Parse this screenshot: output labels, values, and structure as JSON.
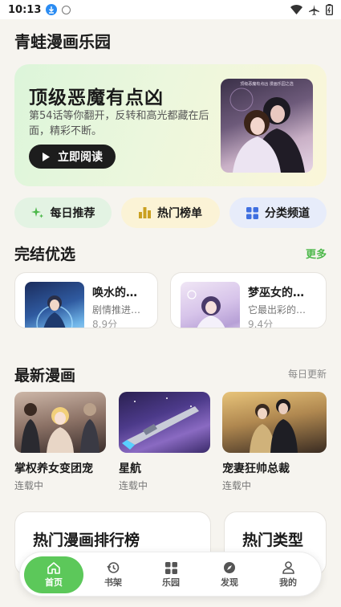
{
  "status": {
    "time": "10:13"
  },
  "app": {
    "title": "青蛙漫画乐园"
  },
  "hero": {
    "title": "顶级恶魔有点凶",
    "desc": "第54话等你翻开，反转和高光都藏在后面，精彩不断。",
    "button": "立即阅读",
    "cover_text": "顶级恶魔有点凶 漫画乐园之选"
  },
  "chips": [
    {
      "label": "每日推荐",
      "icon": "sparkle-icon",
      "color": "#4cb84a"
    },
    {
      "label": "热门榜单",
      "icon": "bar-chart-icon",
      "color": "#caa020"
    },
    {
      "label": "分类频道",
      "icon": "grid-icon",
      "color": "#3f6fe0"
    }
  ],
  "finished": {
    "title": "完结优选",
    "more": "更多",
    "items": [
      {
        "title": "唤水的…",
        "desc": "剧情推进…",
        "score": "8.9分"
      },
      {
        "title": "梦巫女的…",
        "desc": "它最出彩的…",
        "score": "9.4分"
      }
    ]
  },
  "latest": {
    "title": "最新漫画",
    "side": "每日更新",
    "items": [
      {
        "title": "掌权养女变团宠",
        "status": "连载中"
      },
      {
        "title": "星航",
        "status": "连载中"
      },
      {
        "title": "宠妻狂帅总裁",
        "status": "连载中"
      }
    ]
  },
  "bottom_cards": [
    {
      "title": "热门漫画排行榜"
    },
    {
      "title": "热门类型"
    }
  ],
  "tabs": [
    {
      "label": "首页",
      "icon": "home-icon",
      "active": true
    },
    {
      "label": "书架",
      "icon": "history-icon"
    },
    {
      "label": "乐园",
      "icon": "grid-icon"
    },
    {
      "label": "发现",
      "icon": "compass-icon"
    },
    {
      "label": "我的",
      "icon": "person-icon"
    }
  ],
  "colors": {
    "accent": "#5cc85a",
    "background": "#f6f4ef"
  }
}
